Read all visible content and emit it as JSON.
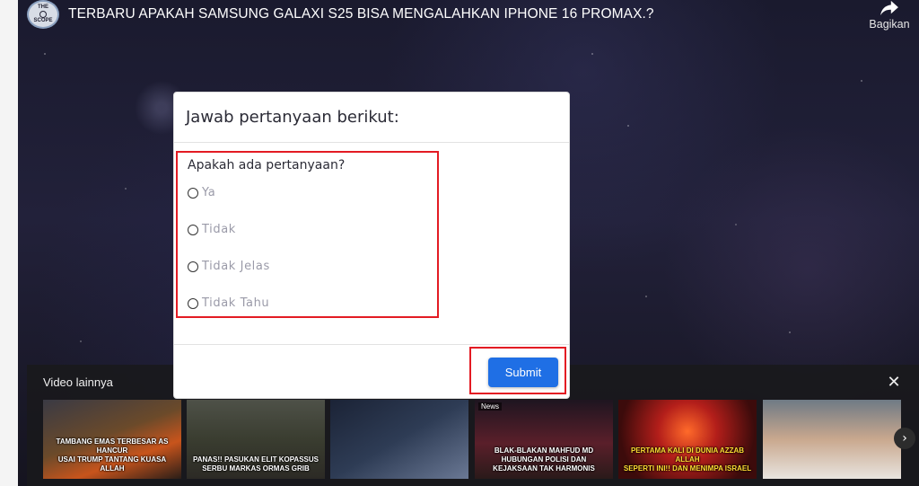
{
  "video": {
    "channel_logo": {
      "top": "THE",
      "bottom": "SCOPE"
    },
    "title": "TERBARU APAKAH SAMSUNG GALAXI S25 BISA MENGALAHKAN IPHONE 16 PROMAX.?",
    "share_label": "Bagikan",
    "share_icon": "share-arrow-icon"
  },
  "more_videos": {
    "title": "Video lainnya",
    "close_icon": "close-icon",
    "next_icon": "chevron-right-icon",
    "thumbnails": [
      {
        "caption": "TAMBANG EMAS TERBESAR AS HANCUR\nUSAI TRUMP TANTANG KUASA ALLAH",
        "tag": ""
      },
      {
        "caption": "PANAS!! PASUKAN ELIT KOPASSUS\nSERBU MARKAS ORMAS GRIB",
        "tag": ""
      },
      {
        "caption": "",
        "tag": ""
      },
      {
        "caption": "BLAK-BLAKAN MAHFUD MD\nHUBUNGAN POLISI DAN\nKEJAKSAAN TAK HARMONIS",
        "tag": "News"
      },
      {
        "caption": "PERTAMA KALI DI DUNIA AZZAB ALLAH\nSEPERTI INI!! DAN MENIMPA ISRAEL",
        "tag": ""
      },
      {
        "caption": "",
        "tag": ""
      }
    ]
  },
  "modal": {
    "title": "Jawab pertanyaan berikut:",
    "question": "Apakah ada pertanyaan?",
    "options": [
      "Ya",
      "Tidak",
      "Tidak Jelas",
      "Tidak Tahu"
    ],
    "submit_label": "Submit"
  },
  "colors": {
    "highlight": "#e31b23",
    "submit_bg": "#1f6fe5",
    "option_text": "#9a9aa8"
  }
}
